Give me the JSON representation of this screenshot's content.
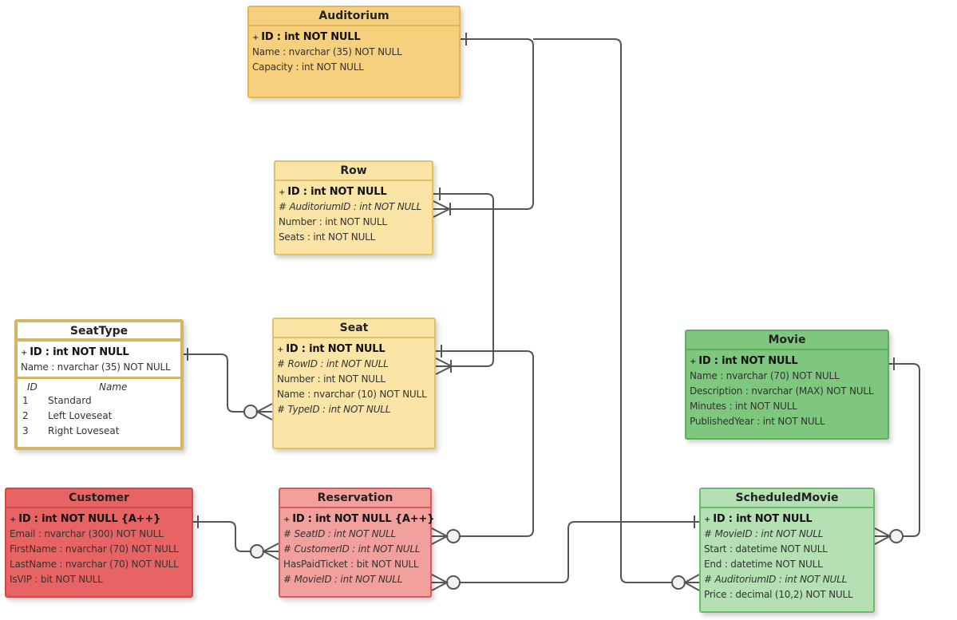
{
  "diagram": {
    "type": "entity-relationship",
    "entities": {
      "auditorium": {
        "name": "Auditorium",
        "attributes": [
          {
            "text": "ID : int NOT NULL",
            "kind": "pk"
          },
          {
            "text": "Name : nvarchar (35)  NOT NULL",
            "kind": "plain"
          },
          {
            "text": "Capacity : int NOT NULL",
            "kind": "plain"
          }
        ]
      },
      "row": {
        "name": "Row",
        "attributes": [
          {
            "text": "ID : int NOT NULL",
            "kind": "pk"
          },
          {
            "text": "# AuditoriumID : int NOT NULL",
            "kind": "fk"
          },
          {
            "text": "Number : int NOT NULL",
            "kind": "plain"
          },
          {
            "text": "Seats : int NOT NULL",
            "kind": "plain"
          }
        ]
      },
      "seattype": {
        "name": "SeatType",
        "attributes": [
          {
            "text": "ID : int NOT NULL",
            "kind": "pk"
          },
          {
            "text": "Name : nvarchar (35)  NOT NULL",
            "kind": "plain"
          }
        ],
        "lookup": {
          "columns": [
            "ID",
            "Name"
          ],
          "rows": [
            [
              "1",
              "Standard"
            ],
            [
              "2",
              "Left Loveseat"
            ],
            [
              "3",
              "Right Loveseat"
            ]
          ]
        }
      },
      "seat": {
        "name": "Seat",
        "attributes": [
          {
            "text": "ID : int NOT NULL",
            "kind": "pk"
          },
          {
            "text": "# RowID : int NOT NULL",
            "kind": "fk"
          },
          {
            "text": "Number : int NOT NULL",
            "kind": "plain"
          },
          {
            "text": "Name : nvarchar (10)  NOT NULL",
            "kind": "plain"
          },
          {
            "text": "# TypeID : int NOT NULL",
            "kind": "fk"
          }
        ]
      },
      "movie": {
        "name": "Movie",
        "attributes": [
          {
            "text": "ID : int NOT NULL",
            "kind": "pk"
          },
          {
            "text": "Name : nvarchar (70)  NOT NULL",
            "kind": "plain"
          },
          {
            "text": "Description : nvarchar (MAX)  NOT NULL",
            "kind": "plain"
          },
          {
            "text": "Minutes : int NOT NULL",
            "kind": "plain"
          },
          {
            "text": "PublishedYear : int NOT NULL",
            "kind": "plain"
          }
        ]
      },
      "customer": {
        "name": "Customer",
        "attributes": [
          {
            "text": "ID : int NOT NULL  {A++}",
            "kind": "pk"
          },
          {
            "text": "Email : nvarchar (300)  NOT NULL",
            "kind": "plain"
          },
          {
            "text": "FirstName : nvarchar (70)  NOT NULL",
            "kind": "plain"
          },
          {
            "text": "LastName : nvarchar (70)  NOT NULL",
            "kind": "plain"
          },
          {
            "text": "IsVIP : bit NOT NULL",
            "kind": "plain"
          }
        ]
      },
      "reservation": {
        "name": "Reservation",
        "attributes": [
          {
            "text": "ID : int NOT NULL  {A++}",
            "kind": "pk"
          },
          {
            "text": "# SeatID : int NOT NULL",
            "kind": "fk"
          },
          {
            "text": "# CustomerID : int NOT NULL",
            "kind": "fk"
          },
          {
            "text": "HasPaidTicket : bit NOT NULL",
            "kind": "plain"
          },
          {
            "text": "# MovieID : int NOT NULL",
            "kind": "fk"
          }
        ]
      },
      "scheduledmovie": {
        "name": "ScheduledMovie",
        "attributes": [
          {
            "text": "ID : int NOT NULL",
            "kind": "pk"
          },
          {
            "text": "# MovieID : int NOT NULL",
            "kind": "fk"
          },
          {
            "text": "Start : datetime NOT NULL",
            "kind": "plain"
          },
          {
            "text": "End : datetime NOT NULL",
            "kind": "plain"
          },
          {
            "text": "# AuditoriumID : int NOT NULL",
            "kind": "fk"
          },
          {
            "text": "Price : decimal (10,2)  NOT NULL",
            "kind": "plain"
          }
        ]
      }
    },
    "relationships": [
      {
        "from": "Auditorium.ID",
        "to": "Row.AuditoriumID",
        "from_end": "one",
        "to_end": "one-or-many"
      },
      {
        "from": "Auditorium.ID",
        "to": "ScheduledMovie.AuditoriumID",
        "from_end": "one",
        "to_end": "zero-or-many"
      },
      {
        "from": "Row.ID",
        "to": "Seat.RowID",
        "from_end": "one",
        "to_end": "one-or-many"
      },
      {
        "from": "SeatType.ID",
        "to": "Seat.TypeID",
        "from_end": "one",
        "to_end": "zero-or-many"
      },
      {
        "from": "Seat.ID",
        "to": "Reservation.SeatID",
        "from_end": "one",
        "to_end": "zero-or-many"
      },
      {
        "from": "Customer.ID",
        "to": "Reservation.CustomerID",
        "from_end": "one",
        "to_end": "zero-or-many"
      },
      {
        "from": "ScheduledMovie.ID",
        "to": "Reservation.MovieID",
        "from_end": "one",
        "to_end": "zero-or-many"
      },
      {
        "from": "Movie.ID",
        "to": "ScheduledMovie.MovieID",
        "from_end": "one",
        "to_end": "zero-or-many"
      }
    ],
    "colors": {
      "line": "#555555",
      "auditorium": "#f6d07c",
      "row_seat": "#fae4a6",
      "movie": "#7fc67f",
      "scheduledmovie": "#b4e0b4",
      "customer": "#e86464",
      "reservation": "#f2a09e"
    }
  }
}
